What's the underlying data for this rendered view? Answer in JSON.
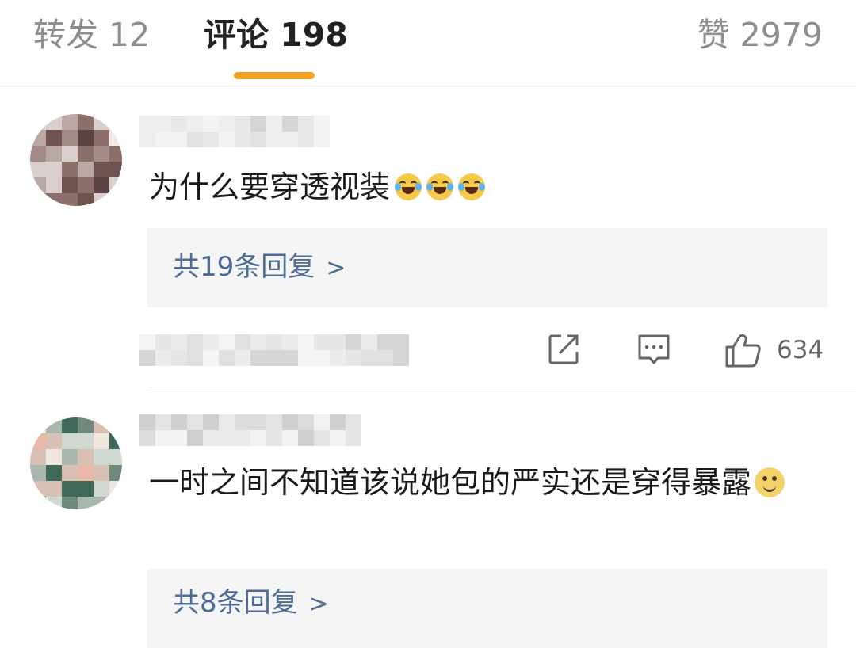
{
  "tabs": {
    "reposts": "转发 12",
    "comments": "评论 198",
    "likes": "赞 2979",
    "active_color": "#f2a324"
  },
  "comments": [
    {
      "text": "为什么要穿透视装",
      "emoji": [
        "laugh-cry-emoji",
        "laugh-cry-emoji",
        "laugh-cry-emoji"
      ],
      "replies_label": "共19条回复",
      "like_count": "634"
    },
    {
      "text": "一时之间不知道该说她包的严实还是穿得暴露",
      "emoji": [
        "awkward-smile-emoji"
      ],
      "replies_label": "共8条回复"
    }
  ],
  "colors": {
    "link": "#4f6c96",
    "reply_box": "#f5f5f5",
    "icon": "#666666"
  }
}
